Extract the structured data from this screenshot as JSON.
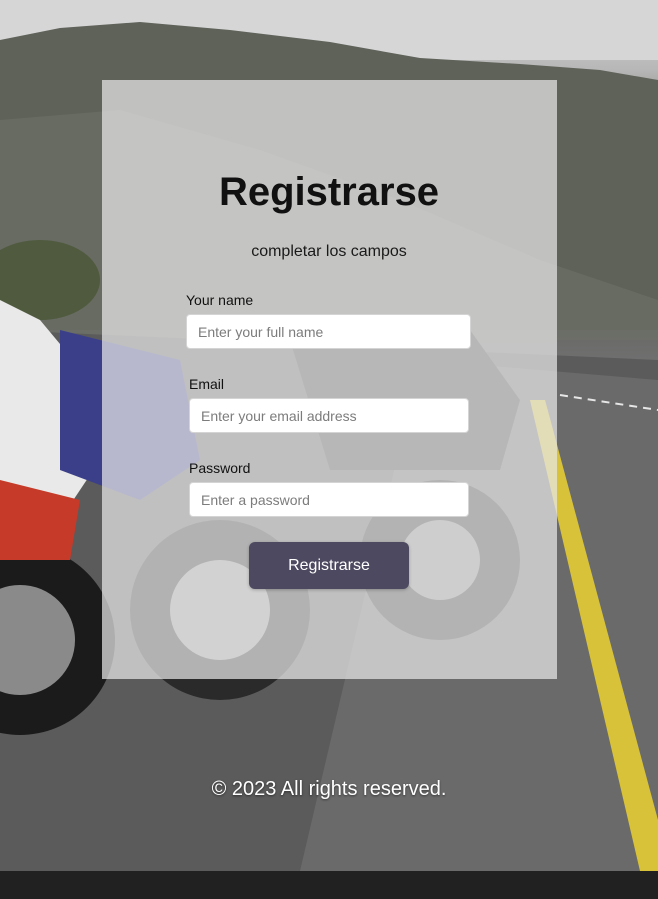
{
  "form": {
    "title": "Registrarse",
    "subtitle": "completar los campos",
    "name_label": "Your name",
    "name_placeholder": "Enter your full name",
    "email_label": "Email",
    "email_placeholder": "Enter your email address",
    "password_label": "Password",
    "password_placeholder": "Enter a password",
    "submit_label": "Registrarse"
  },
  "footer": {
    "copyright": "© 2023 All rights reserved."
  },
  "colors": {
    "button": "#4d4960",
    "card_overlay": "rgba(232,232,232,0.72)",
    "footer_bar": "#212121",
    "road_line": "#d8c23a"
  }
}
